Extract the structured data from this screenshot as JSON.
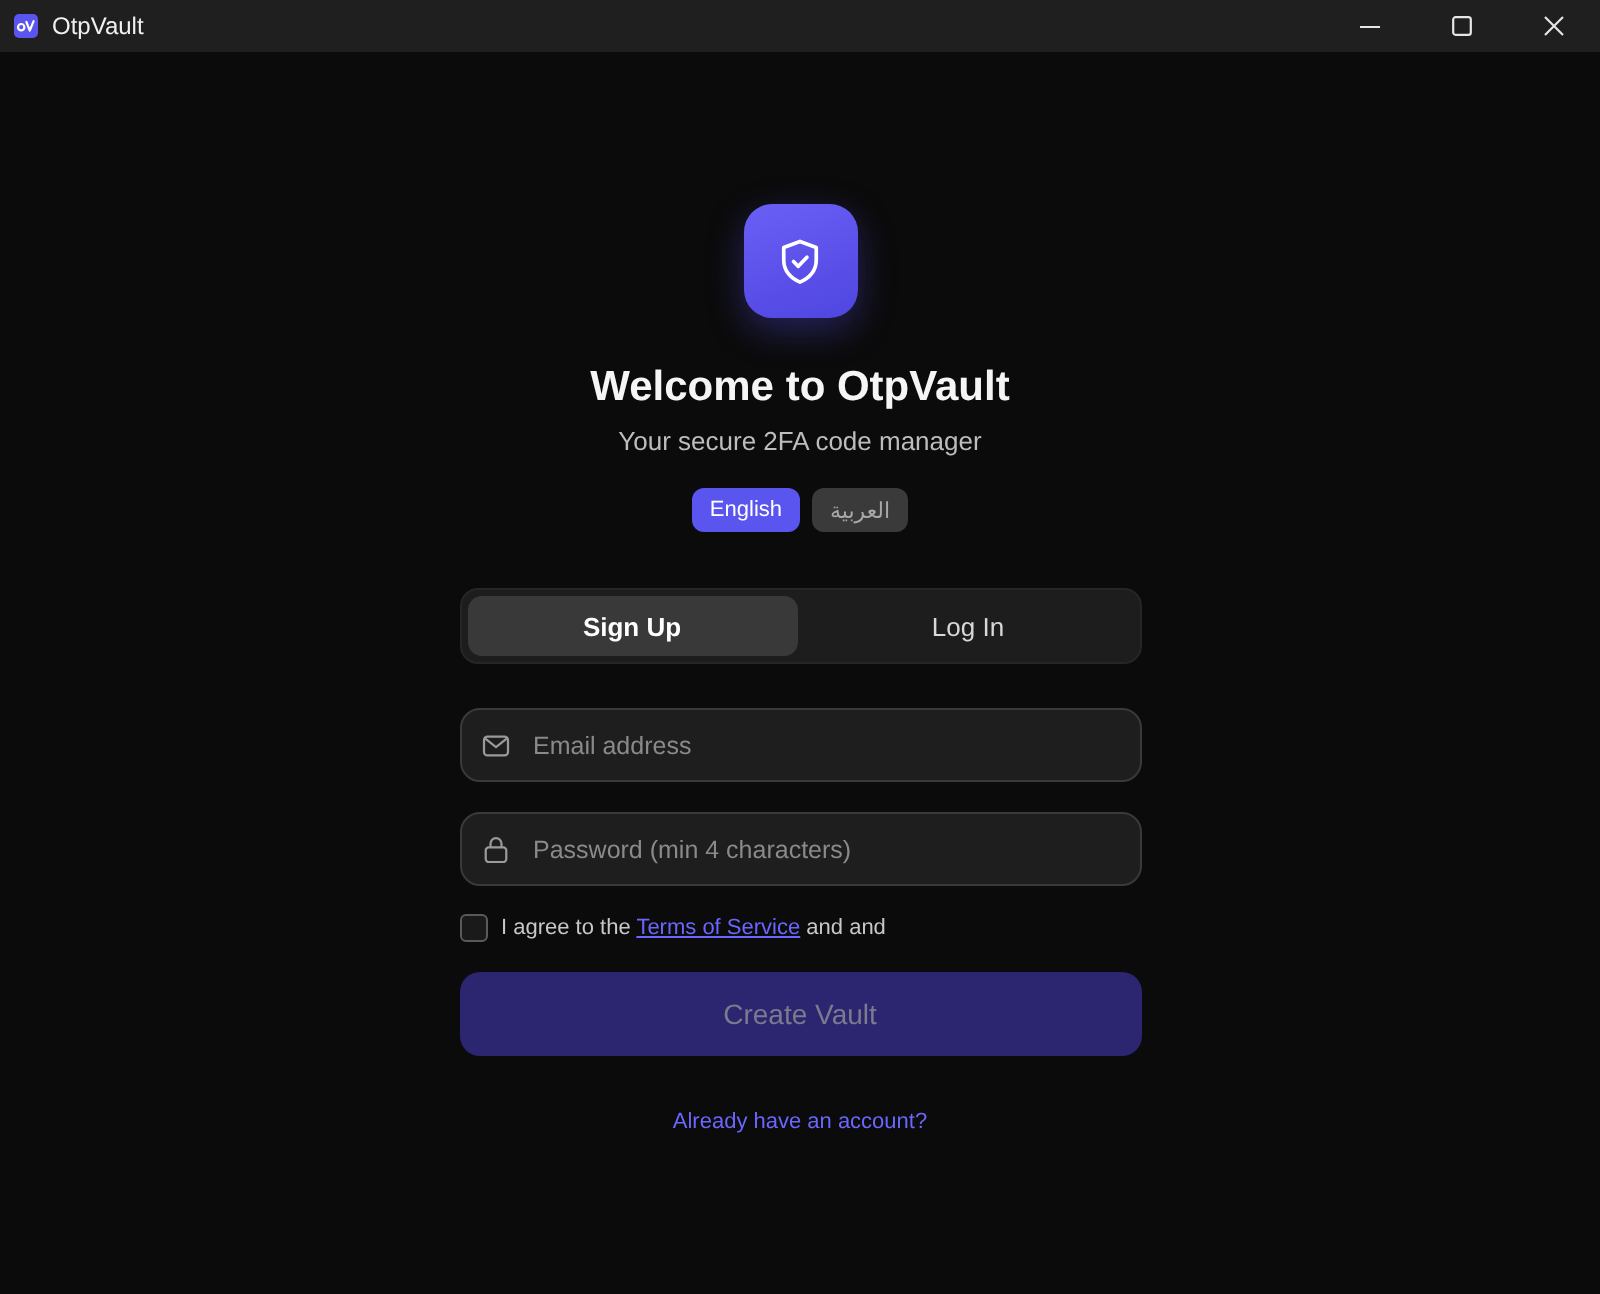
{
  "window": {
    "title": "OtpVault"
  },
  "header": {
    "title": "Welcome to OtpVault",
    "subtitle": "Your secure 2FA code manager"
  },
  "languages": [
    {
      "label": "English",
      "selected": true
    },
    {
      "label": "العربية",
      "selected": false
    }
  ],
  "tabs": [
    {
      "label": "Sign Up",
      "selected": true
    },
    {
      "label": "Log In",
      "selected": false
    }
  ],
  "fields": [
    {
      "kind": "email",
      "placeholder": "Email address"
    },
    {
      "kind": "password",
      "placeholder": "Password (min 4 characters)"
    }
  ],
  "agreement": {
    "checked": false,
    "text_before": "I agree to the",
    "link": "Terms of Service",
    "text_after": "and and"
  },
  "submit": {
    "label": "Create Vault",
    "disabled": true
  },
  "footer_link": "Already have an account?"
}
